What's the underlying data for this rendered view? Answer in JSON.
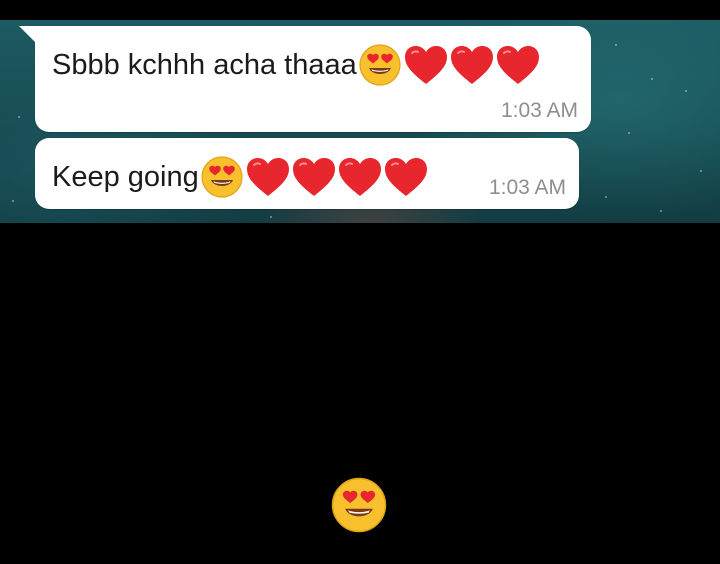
{
  "messages": [
    {
      "text": "Sbbb kchhh acha thaaa",
      "emojis": [
        "heart-eyes",
        "red-heart",
        "red-heart",
        "red-heart"
      ],
      "time": "1:03 AM"
    },
    {
      "text": "Keep going",
      "emojis": [
        "heart-eyes",
        "red-heart",
        "red-heart",
        "red-heart",
        "red-heart"
      ],
      "time": "1:03 AM"
    }
  ],
  "reaction": {
    "emoji": "heart-eyes"
  },
  "colors": {
    "bubble": "#ffffff",
    "time_text": "#8e8e8e",
    "chat_background": "#174b52",
    "heart": "#e8262d",
    "face": "#f7c02c"
  }
}
